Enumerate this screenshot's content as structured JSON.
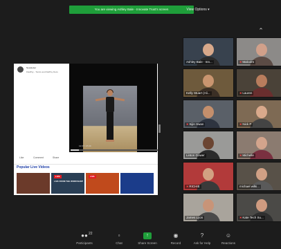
{
  "banner": {
    "text": "You are viewing Ashley Bale - Innovate Trust's screen"
  },
  "view_options": {
    "label": "View Options ▾"
  },
  "shared_screen": {
    "page_name": "Newsletter",
    "post_caption": "FitelPsy - Tonics and fitelPsy Docs",
    "video_time": "12:07 / 27:20",
    "progress": 0.06,
    "actions": {
      "like": "Like",
      "comment": "Comment",
      "share": "Share"
    },
    "popular_title": "Popular Live Videos",
    "thumbnails": [
      {
        "badge": "",
        "caption": "",
        "color": "#6b3a2a"
      },
      {
        "badge": "LIVE",
        "caption": "LIVE FROM THE WORKSHOP",
        "color": "#2a3f55"
      },
      {
        "badge": "LIVE",
        "caption": "",
        "color": "#c04a1c"
      },
      {
        "badge": "",
        "caption": "",
        "color": "#1b3c8a"
      }
    ]
  },
  "participants": [
    {
      "name": "Ashley Bale - Inn...",
      "muted": false,
      "bg": "#38424e",
      "skin": "#d7a88a",
      "shirt": "#2b2b2b"
    },
    {
      "name": "Malcolm",
      "muted": true,
      "bg": "#8c8a88",
      "skin": "#d1a08a",
      "shirt": "#5b4b45"
    },
    {
      "name": "Kelly Stuart (Ali...",
      "muted": false,
      "bg": "#6e5a3c",
      "skin": "#c9956f",
      "shirt": "#3b2f25"
    },
    {
      "name": "Lauren",
      "muted": true,
      "bg": "#4a4238",
      "skin": "#b87d5d",
      "shirt": "#6a2e2e"
    },
    {
      "name": "Sijin Swan",
      "muted": true,
      "bg": "#5a6068",
      "skin": "#c48f6c",
      "shirt": "#2e3440"
    },
    {
      "name": "Nick P",
      "muted": true,
      "bg": "#7e6a54",
      "skin": "#d9a98b",
      "shirt": "#444444"
    },
    {
      "name": "Linton Gower",
      "muted": false,
      "bg": "#9a9a98",
      "skin": "#6b4532",
      "shirt": "#2b2b2b"
    },
    {
      "name": "Michelle",
      "muted": true,
      "bg": "#8b7b70",
      "skin": "#d3a48c",
      "shirt": "#7a3040"
    },
    {
      "name": "RICHIE",
      "muted": true,
      "bg": "#b23a3a",
      "skin": "#d2a082",
      "shirt": "#3a3a3a"
    },
    {
      "name": "michael wilki...",
      "muted": false,
      "bg": "#585148",
      "skin": "#d0a085",
      "shirt": "#5a5a5a"
    },
    {
      "name": "James Lyon",
      "muted": false,
      "bg": "#a9a49c",
      "skin": "#c89478",
      "shirt": "#4a4a4a"
    },
    {
      "name": "Kate Tech Su...",
      "muted": true,
      "bg": "#4b4a47",
      "skin": "#cf9b80",
      "shirt": "#2f2f2f"
    }
  ],
  "toolbar": {
    "participants_label": "Participants",
    "participants_count": "22",
    "chat_label": "Chat",
    "share_label": "Share Screen",
    "record_label": "Record",
    "help_label": "Ask for Help",
    "reactions_label": "Reactions"
  },
  "icons": {
    "participants": "participants-icon",
    "chat": "chat-icon",
    "share": "share-screen-icon",
    "record": "record-icon",
    "help": "help-icon",
    "reactions": "reactions-icon"
  },
  "colors": {
    "accent_green": "#1f9e3a",
    "muted_red": "#ff4b4b",
    "popular_blue": "#1f3fa8"
  }
}
